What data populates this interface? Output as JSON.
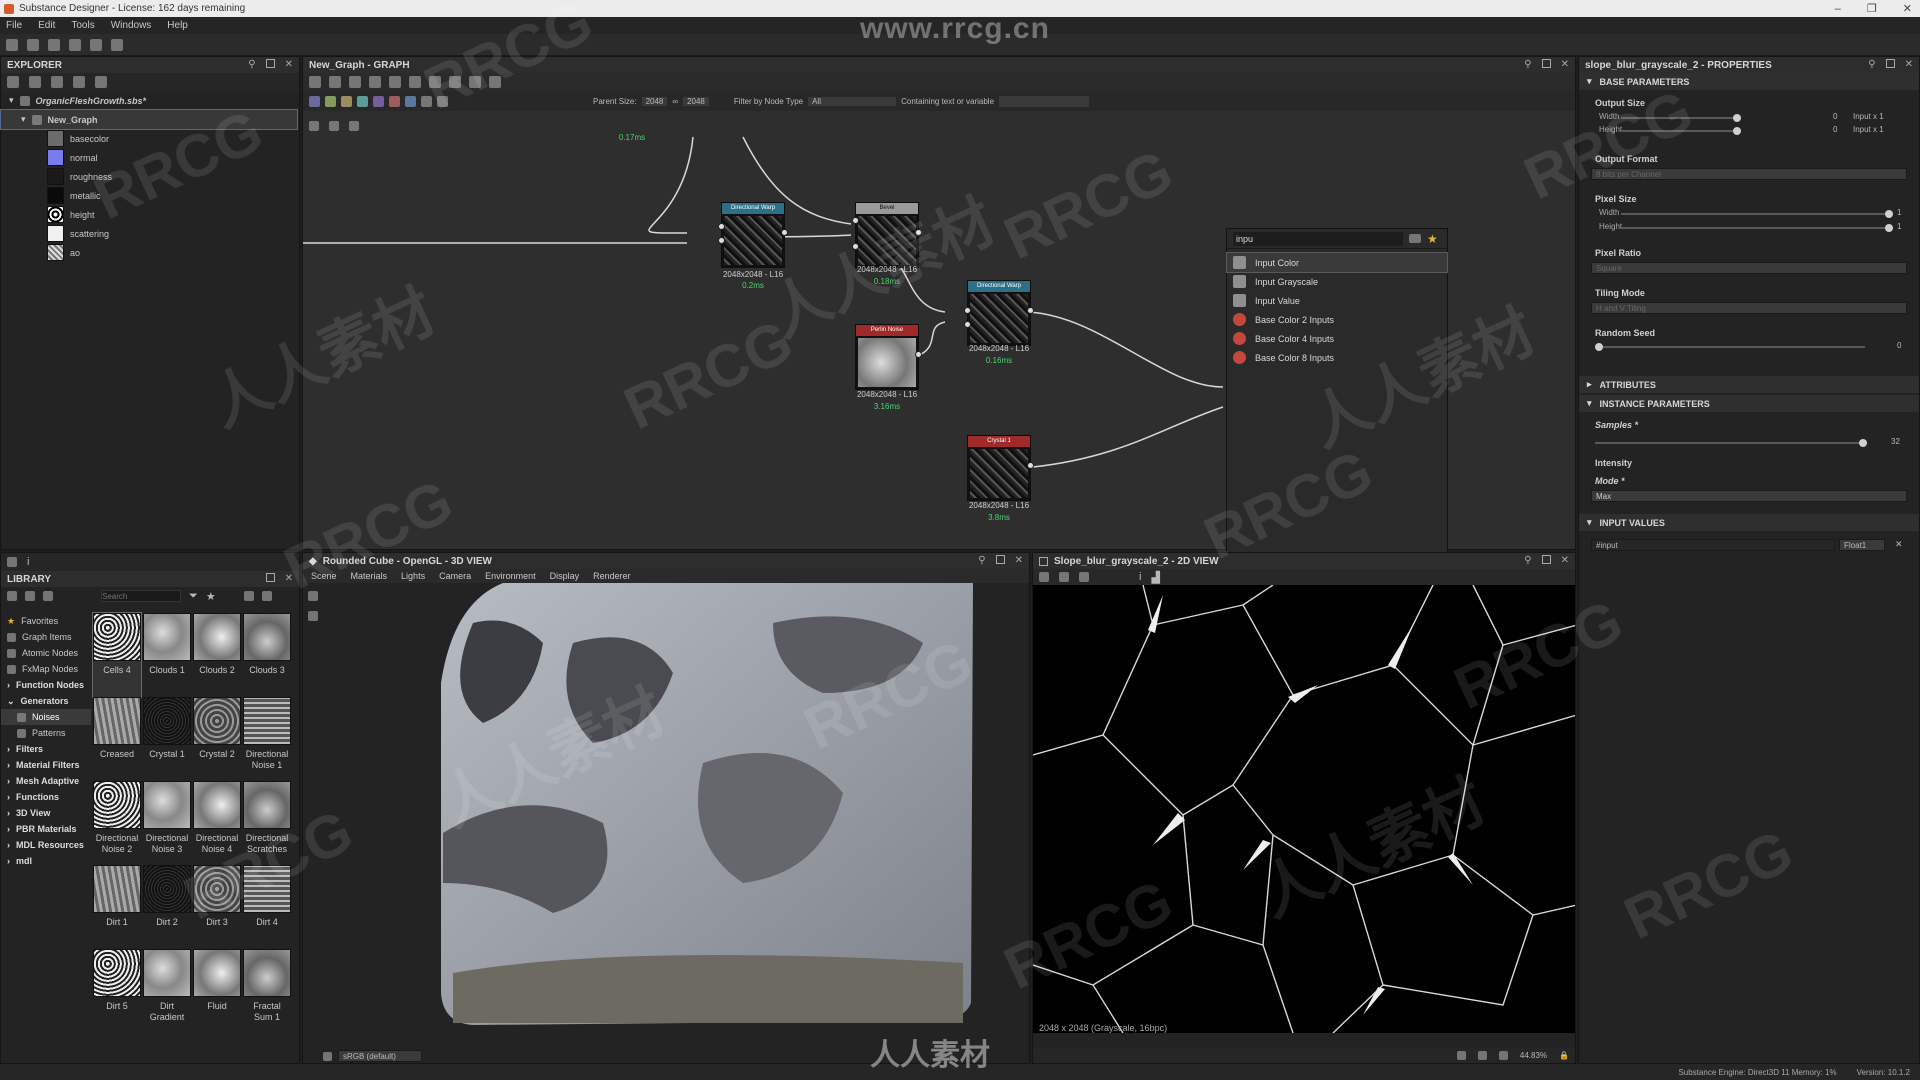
{
  "window": {
    "title": "Substance Designer - License: 162 days remaining"
  },
  "menu": [
    "File",
    "Edit",
    "Tools",
    "Windows",
    "Help"
  ],
  "explorer": {
    "title": "EXPLORER",
    "package": "OrganicFleshGrowth.sbs*",
    "graph": "New_Graph",
    "outputs": [
      "basecolor",
      "normal",
      "roughness",
      "metallic",
      "height",
      "scattering",
      "ao"
    ]
  },
  "graph_panel": {
    "title": "New_Graph - GRAPH",
    "parent_size_label": "Parent Size:",
    "parent_size_w": "2048",
    "parent_size_h": "2048",
    "filter_label": "Filter by Node Type",
    "filter_value": "All",
    "containing_label": "Containing text or variable",
    "top_time": "0.17ms",
    "nodes": [
      {
        "title": "Directional Warp",
        "size": "2048x2048 - L16",
        "time": "0.2ms"
      },
      {
        "title": "Bevel",
        "size": "2048x2048 - L16",
        "time": "0.18ms"
      },
      {
        "title": "Perlin Noise",
        "size": "2048x2048 - L16",
        "time": "3.16ms"
      },
      {
        "title": "Directional Warp",
        "size": "2048x2048 - L16",
        "time": "0.16ms"
      },
      {
        "title": "Crystal 1",
        "size": "2048x2048 - L16",
        "time": "3.8ms"
      }
    ]
  },
  "search_popup": {
    "query": "inpu",
    "items": [
      "Input Color",
      "Input Grayscale",
      "Input Value",
      "Base Color 2 Inputs",
      "Base Color 4 Inputs",
      "Base Color 8 Inputs"
    ]
  },
  "properties": {
    "title": "slope_blur_grayscale_2 - PROPERTIES",
    "sections": {
      "base": "BASE PARAMETERS",
      "attributes": "ATTRIBUTES",
      "instance": "INSTANCE PARAMETERS",
      "input_values": "INPUT VALUES"
    },
    "output_size": "Output Size",
    "width": "Width",
    "height": "Height",
    "width_val": "0",
    "height_val": "0",
    "width_mode": "Input x 1",
    "height_mode": "Input x 1",
    "output_format": "Output Format",
    "output_format_val": "8 bits per Channel",
    "pixel_size": "Pixel Size",
    "ps_width_val": "1",
    "ps_height_val": "1",
    "pixel_ratio": "Pixel Ratio",
    "pixel_ratio_val": "Square",
    "tiling_mode": "Tiling Mode",
    "tiling_mode_val": "H and V Tiling",
    "random_seed": "Random Seed",
    "random_seed_val": "0",
    "samples": "Samples *",
    "samples_val": "32",
    "samples_fill": 1.0,
    "intensity": "Intensity",
    "mode": "Mode *",
    "mode_val": "Max",
    "input_name": "#input",
    "input_type": "Float1"
  },
  "library": {
    "title": "LIBRARY",
    "search_placeholder": "Search",
    "categories": [
      "Favorites",
      "Graph Items",
      "Atomic Nodes",
      "FxMap Nodes",
      "Function Nodes",
      "Generators",
      "Noises",
      "Patterns",
      "Filters",
      "Material Filters",
      "Mesh Adaptive",
      "Functions",
      "3D View",
      "PBR Materials",
      "MDL Resources",
      "mdl"
    ],
    "items": [
      "Cells 4",
      "Clouds 1",
      "Clouds 2",
      "Clouds 3",
      "Creased",
      "Crystal 1",
      "Crystal 2",
      "Directional Noise 1",
      "Directional Noise 2",
      "Directional Noise 3",
      "Directional Noise 4",
      "Directional Scratches",
      "Dirt 1",
      "Dirt 2",
      "Dirt 3",
      "Dirt 4",
      "Dirt 5",
      "Dirt Gradient",
      "Fluid",
      "Fractal Sum 1"
    ]
  },
  "view3d": {
    "title": "Rounded Cube - OpenGL - 3D VIEW",
    "menu": [
      "Scene",
      "Materials",
      "Lights",
      "Camera",
      "Environment",
      "Display",
      "Renderer"
    ],
    "colorspace": "sRGB (default)"
  },
  "view2d": {
    "title": "Slope_blur_grayscale_2 - 2D VIEW",
    "info": "2048 x 2048 (Grayscale, 16bpc)",
    "zoom": "44.83%"
  },
  "status": {
    "engine": "Substance Engine: Direct3D 11  Memory: 1%",
    "version": "Version: 10.1.2"
  },
  "watermarks": {
    "site": "www.rrcg.cn",
    "brand": "RRCG",
    "cn": "人人素材"
  }
}
